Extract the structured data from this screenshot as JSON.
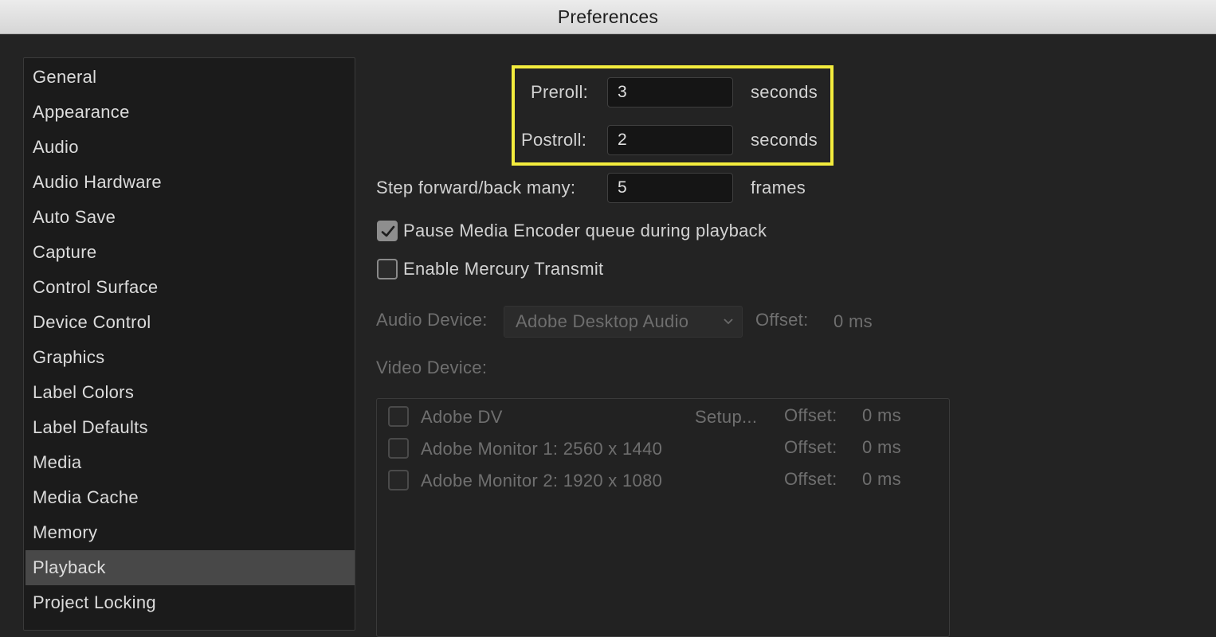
{
  "window": {
    "title": "Preferences"
  },
  "sidebar": {
    "items": [
      {
        "label": "General"
      },
      {
        "label": "Appearance"
      },
      {
        "label": "Audio"
      },
      {
        "label": "Audio Hardware"
      },
      {
        "label": "Auto Save"
      },
      {
        "label": "Capture"
      },
      {
        "label": "Control Surface"
      },
      {
        "label": "Device Control"
      },
      {
        "label": "Graphics"
      },
      {
        "label": "Label Colors"
      },
      {
        "label": "Label Defaults"
      },
      {
        "label": "Media"
      },
      {
        "label": "Media Cache"
      },
      {
        "label": "Memory"
      },
      {
        "label": "Playback"
      },
      {
        "label": "Project Locking"
      }
    ],
    "selected": "Playback"
  },
  "playback": {
    "preroll": {
      "label": "Preroll:",
      "value": "3",
      "unit": "seconds"
    },
    "postroll": {
      "label": "Postroll:",
      "value": "2",
      "unit": "seconds"
    },
    "step": {
      "label": "Step forward/back many:",
      "value": "5",
      "unit": "frames"
    },
    "pause_encoder": {
      "label": "Pause Media Encoder queue during playback",
      "checked": true
    },
    "mercury": {
      "label": "Enable Mercury Transmit",
      "checked": false
    },
    "audio_device": {
      "label": "Audio Device:",
      "selected": "Adobe Desktop Audio",
      "offset_label": "Offset:",
      "offset_value": "0 ms"
    },
    "video_device": {
      "label": "Video Device:",
      "devices": [
        {
          "name": "Adobe DV",
          "setup": "Setup...",
          "offset_label": "Offset:",
          "offset_value": "0 ms"
        },
        {
          "name": "Adobe Monitor 1: 2560 x 1440",
          "setup": "",
          "offset_label": "Offset:",
          "offset_value": "0 ms"
        },
        {
          "name": "Adobe Monitor 2: 1920 x 1080",
          "setup": "",
          "offset_label": "Offset:",
          "offset_value": "0 ms"
        }
      ]
    }
  },
  "colors": {
    "highlight": "#f3ec3d",
    "selected_item": "#484848"
  }
}
